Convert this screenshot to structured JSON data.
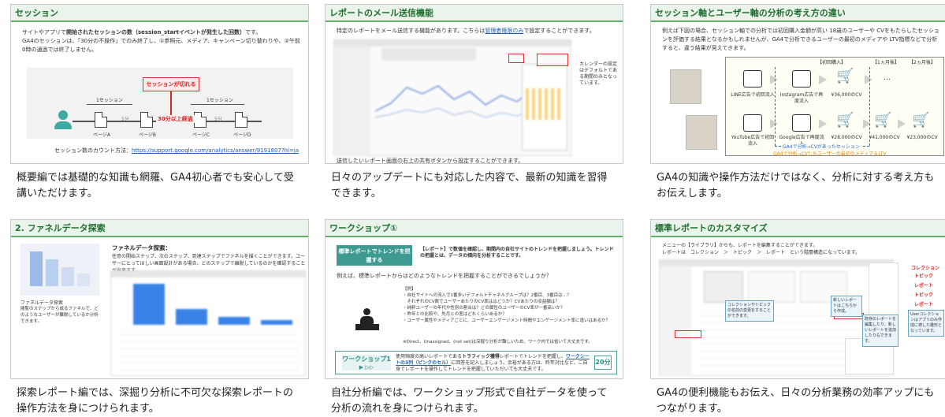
{
  "cards": [
    {
      "title": "セッション",
      "caption": "概要編では基礎的な知識も網羅、GA4初心者でも安心して受講いただけます。",
      "text_pre": "サイトやアプリで",
      "text_bold": "開始されたセッションの数（session_startイベントが発生した回数）",
      "text_post": "です。",
      "text_line2": "GA4のセッションは、「30分の不操作」でのみ終了し、①参照元、メディア、キャンペーン切り替わりや、②午前0時の通過では終了しません。",
      "cut_label": "セッションが切れる",
      "session_label": "1セッション",
      "gap_short": "5分",
      "gap_long": "30分以上経過",
      "pages": [
        "ページA",
        "ページB",
        "ページC",
        "ページD"
      ],
      "url_label": "セッション数のカウント方法：",
      "url": "https://support.google.com/analytics/answer/9191807?hl=ja"
    },
    {
      "title": "レポートのメール送信機能",
      "caption": "日々のアップデートにも対応した内容で、最新の知識を習得できます。",
      "text_pre": "特定のレポートをメール送信する機能があります。こちらは",
      "text_link": "管理者権限のみ",
      "text_post": "で設定することができます。",
      "side_note": "カレンダーの設定はデフォルトである期間のみとなっています。",
      "bottom_note": "送信したいレポート画面の右上の共有ボタンから設定することができます。"
    },
    {
      "title": "セッション軸とユーザー軸の分析の考え方の違い",
      "caption": "GA4の知識や操作方法だけではなく、分析に対する考え方もお伝えします。",
      "text": "例えば下図の場合、セッション軸での分析では初回購入金額が高い 18歳のユーザーや CVをもたらしたセッションを評価する結果となるかもしれませんが、GA4で分析できるユーザーの最初のメディアや LTV指標などで分析すると、違う結果が見えてきます。",
      "col_headers": [
        "【初回購入】",
        "【1ヵ月後】",
        "【2ヵ月後】"
      ],
      "row1": [
        "LINE広告で初回流入",
        "Instagram広告で再度流入",
        "¥36,000のCV",
        "…"
      ],
      "row2": [
        "YouTube広告で初回流入",
        "Google広告で再度流入",
        "¥28,000のCV",
        "¥41,000のCV",
        "¥23,000のCV"
      ],
      "session_note": "GA4で分析→CVがあったセッション",
      "user_note": "GA4で分析→CVしたユーザーの最初のメディア＆LTV"
    },
    {
      "title": "2. ファネルデータ探索",
      "caption": "探索レポート編では、深掘り分析に不可欠な探索レポートの操作方法を身につけられます。",
      "heading": "ファネルデータ探索：",
      "text": "任意の開始ステップ、次のステップ、到達ステップでファネルを描くことができます。ユーザーにとってほしい画面設計がある場合、どのステップで離脱しているのかを確認することが出来ます。",
      "left_title": "ファネルデータ探索",
      "left_text": "閲覧のステップから成るファネルで、どのようなユーザーが離脱しているか分析できます。"
    },
    {
      "title": "ワークショップ①",
      "caption": "自社分析編では、ワークショップ形式で自社データを使って分析の流れを身につけられます。",
      "banner": "標準レポートでトレンドを把握する",
      "banner_text": "【レポート】で数値を確認し、期間内の自社サイトのトレンドを把握しましょう。トレンドの把握とは、データの傾向を分析することです。",
      "question": "例えば、標準レポートからはどのようなトレンドを把握することができるでしょうか？",
      "examples": [
        "【例】",
        "・自社サイトへの流入で1番多いデフォルトチャネルグループは？2番目、3番目は…？",
        "　それぞれのCV数でユーザーあたりのCV率ははどうか？CVあたりの収益額は？",
        "・純粋ユーザーの年代や性別の割合は？どの属性のユーザーのCV率が一番高いか？",
        "・昨年との比較や、先月との差はどれくらいあるか？",
        "・ユーザー属性やメディアごとに、ユーザーエンゲージメント時間やエンゲージメント率に違いはあるか？"
      ],
      "note": "※Direct、Unassigned、(not set)は深掘り分析が難しいため、ワーク内では省いて大丈夫です。",
      "ws_label": "ワークショップ1",
      "ws_text_pre": "使用頻度の高いレポートである",
      "ws_text_bold": "トラフィック獲得",
      "ws_text_mid": "レポートでトレンドを把握し、",
      "ws_text_link": "ワークシートの3列（ピンクのセル）",
      "ws_text_post": "に回答を記入しましょう。余裕がある方は、昨年対比など、ご自身でレポートを操作してトレンドを把握していただいても大丈夫です。",
      "ws_time": "20分"
    },
    {
      "title": "標準レポートのカスタマイズ",
      "caption": "GA4の便利機能もお伝え、日々の分析業務の効率アップにもつながります。",
      "text1": "メニューの【ライブラリ】からも、レポートを編集することができます。",
      "text2": "レポートは　コレクション　＞　トピック　＞　レポート　という階層構造になっています。",
      "red_labels": [
        "コレクション",
        "トピック",
        "レポート",
        "トピック",
        "レポート"
      ],
      "callouts": [
        "コレクションやトピックの名前の変更をすることができます。",
        "新しいレポートはこちらから作成。",
        "既存のレポートを編集したり、新しいレポートを追加したりもできます。",
        "Userコレクションはアプリのみ作成に適した雛形となっています。"
      ]
    }
  ],
  "colors": {
    "header_bg": "#eaf4ea",
    "header_text": "#1f6f2f",
    "accent_red": "#e03030",
    "teal": "#3e9a91",
    "link_blue": "#1a5fb4",
    "bar_blue": "#3b82e6"
  }
}
